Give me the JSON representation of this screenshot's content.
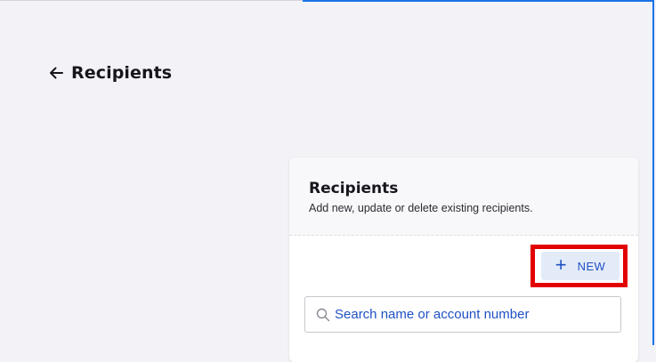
{
  "header": {
    "back_icon": "arrow-left-icon",
    "title": "Recipients"
  },
  "card": {
    "title": "Recipients",
    "subtitle": "Add new, update or delete existing recipients."
  },
  "toolbar": {
    "new_button_icon": "plus-icon",
    "new_button_label": "NEW",
    "highlight_color": "#e30000"
  },
  "search": {
    "icon": "search-icon",
    "placeholder": "Search name or account number",
    "value": ""
  },
  "colors": {
    "page_background": "#f3f3f7",
    "accent": "#1f51c4",
    "frame_border": "#1a73e8"
  }
}
